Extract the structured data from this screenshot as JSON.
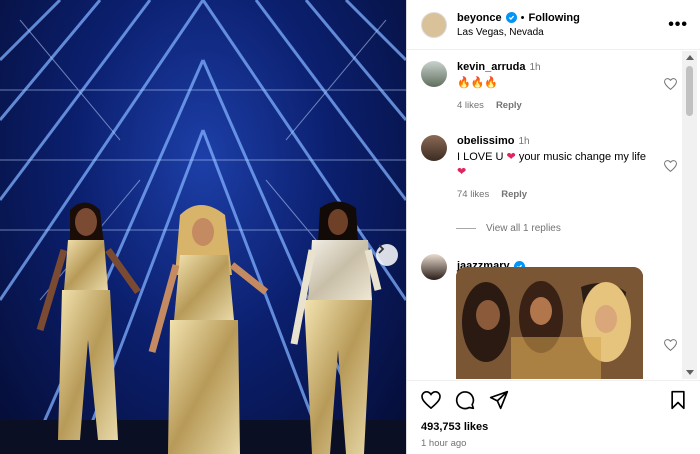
{
  "post": {
    "username": "beyonce",
    "follow_status": "Following",
    "location": "Las Vegas, Nevada",
    "likes": "493,753 likes",
    "time_ago": "1 hour ago"
  },
  "comments": [
    {
      "username": "kevin_arruda",
      "time": "1h",
      "text": "🔥🔥🔥",
      "likes": "4 likes",
      "reply": "Reply"
    },
    {
      "username": "obelissimo",
      "time": "1h",
      "text_prefix": "I LOVE U",
      "text_mid": "your music change my",
      "text_end": "life",
      "likes": "74 likes",
      "reply": "Reply",
      "view_replies": "View all 1 replies"
    },
    {
      "username": "jaazzmary",
      "verified": true
    }
  ],
  "colors": {
    "verified": "#0095f6",
    "heart": "#e0245e",
    "stage_blue": "#1d3fa8"
  },
  "icons": [
    "heart-icon",
    "comment-icon",
    "share-icon",
    "save-icon",
    "more-icon",
    "next-arrow-icon",
    "verified-icon"
  ]
}
